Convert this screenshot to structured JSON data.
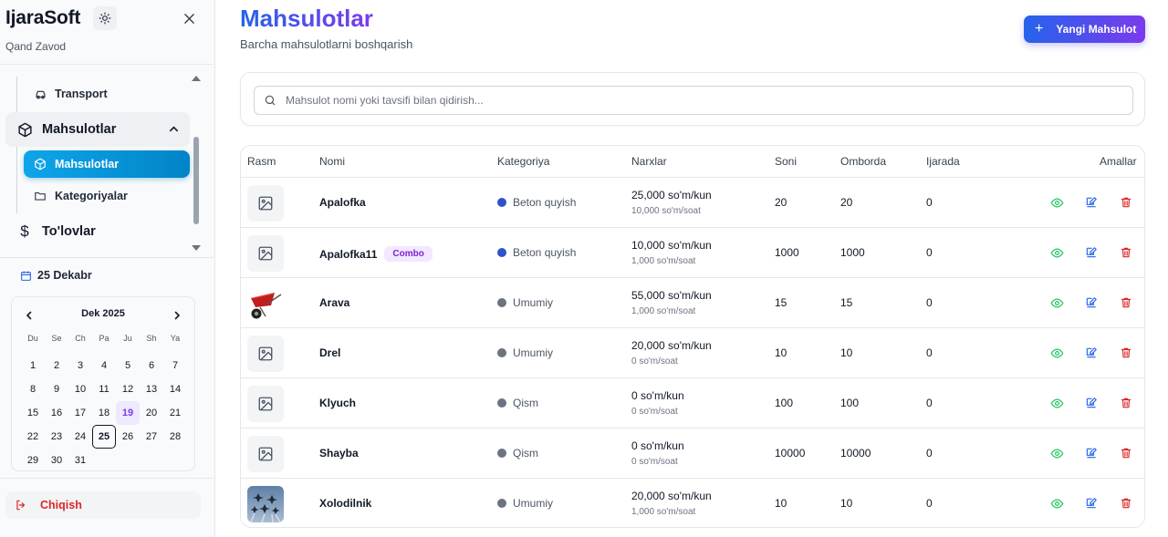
{
  "sidebar": {
    "brand": "IjaraSoft",
    "org": "Qand Zavod",
    "items": {
      "transport": "Transport",
      "mahsulotlar_group": "Mahsulotlar",
      "mahsulotlar": "Mahsulotlar",
      "kategoriyalar": "Kategoriyalar",
      "tolovlar": "To'lovlar"
    },
    "date_label": "25 Dekabr",
    "calendar": {
      "month": "Dek 2025",
      "weekdays": [
        "Du",
        "Se",
        "Ch",
        "Pa",
        "Ju",
        "Sh",
        "Ya"
      ],
      "days": [
        "1",
        "2",
        "3",
        "4",
        "5",
        "6",
        "7",
        "8",
        "9",
        "10",
        "11",
        "12",
        "13",
        "14",
        "15",
        "16",
        "17",
        "18",
        "19",
        "20",
        "21",
        "22",
        "23",
        "24",
        "25",
        "26",
        "27",
        "28",
        "29",
        "30",
        "31"
      ],
      "today": "19",
      "selected": "25"
    },
    "logout": "Chiqish"
  },
  "header": {
    "title": "Mahsulotlar",
    "subtitle": "Barcha mahsulotlarni boshqarish",
    "new_button": "Yangi Mahsulot"
  },
  "search": {
    "placeholder": "Mahsulot nomi yoki tavsifi bilan qidirish..."
  },
  "table": {
    "columns": {
      "rasm": "Rasm",
      "nomi": "Nomi",
      "kategoriya": "Kategoriya",
      "narxlar": "Narxlar",
      "soni": "Soni",
      "omborda": "Omborda",
      "ijarada": "Ijarada",
      "amallar": "Amallar"
    },
    "rows": [
      {
        "name": "Apalofka",
        "badge": "",
        "category": "Beton quyish",
        "cat_color": "#2f52c8",
        "price_day": "25,000 so'm/kun",
        "price_hour": "10,000 so'm/soat",
        "soni": "20",
        "omborda": "20",
        "ijarada": "0",
        "image": "placeholder-icon"
      },
      {
        "name": "Apalofka11",
        "badge": "Combo",
        "category": "Beton quyish",
        "cat_color": "#2f52c8",
        "price_day": "10,000 so'm/kun",
        "price_hour": "1,000 so'm/soat",
        "soni": "1000",
        "omborda": "1000",
        "ijarada": "0",
        "image": "placeholder-icon"
      },
      {
        "name": "Arava",
        "badge": "",
        "category": "Umumiy",
        "cat_color": "#6b7280",
        "price_day": "55,000 so'm/kun",
        "price_hour": "1,000 so'm/soat",
        "soni": "15",
        "omborda": "15",
        "ijarada": "0",
        "image": "wheelbarrow-photo"
      },
      {
        "name": "Drel",
        "badge": "",
        "category": "Umumiy",
        "cat_color": "#6b7280",
        "price_day": "20,000 so'm/kun",
        "price_hour": "0 so'm/soat",
        "soni": "10",
        "omborda": "10",
        "ijarada": "0",
        "image": "placeholder-icon"
      },
      {
        "name": "Klyuch",
        "badge": "",
        "category": "Qism",
        "cat_color": "#6b7280",
        "price_day": "0 so'm/kun",
        "price_hour": "0 so'm/soat",
        "soni": "100",
        "omborda": "100",
        "ijarada": "0",
        "image": "placeholder-icon"
      },
      {
        "name": "Shayba",
        "badge": "",
        "category": "Qism",
        "cat_color": "#6b7280",
        "price_day": "0 so'm/kun",
        "price_hour": "0 so'm/soat",
        "soni": "10000",
        "omborda": "10000",
        "ijarada": "0",
        "image": "placeholder-icon"
      },
      {
        "name": "Xolodilnik",
        "badge": "",
        "category": "Umumiy",
        "cat_color": "#6b7280",
        "price_day": "20,000 so'm/kun",
        "price_hour": "1,000 so'm/soat",
        "soni": "10",
        "omborda": "10",
        "ijarada": "0",
        "image": "jets-photo"
      }
    ]
  },
  "colors": {
    "accent_start": "#2563eb",
    "accent_end": "#7c3aed",
    "active_nav": "#0ea5e9",
    "view_icon": "#22c55e",
    "edit_icon": "#2563eb",
    "delete_icon": "#dc2626",
    "logout": "#dc2626"
  }
}
